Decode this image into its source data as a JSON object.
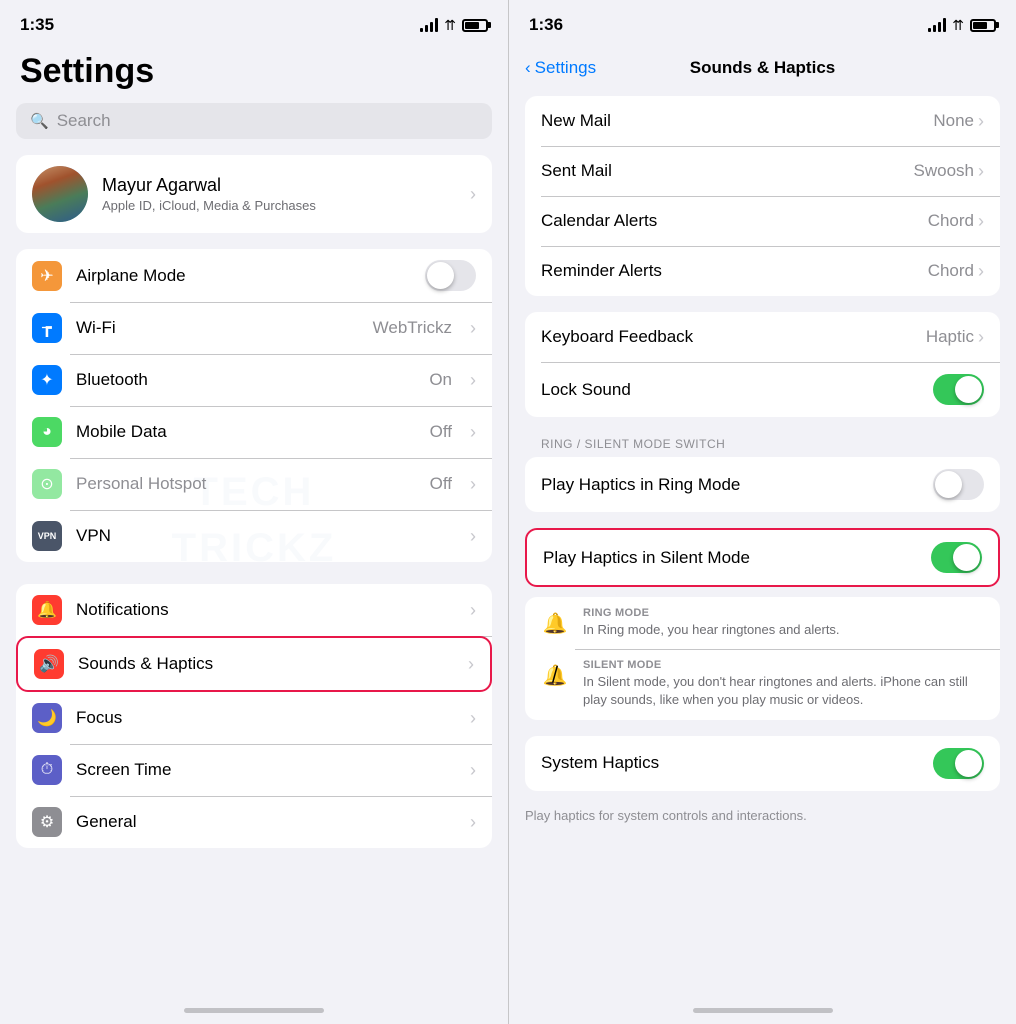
{
  "left": {
    "status": {
      "time": "1:35",
      "battery_label": "battery"
    },
    "title": "Settings",
    "search": {
      "placeholder": "Search"
    },
    "profile": {
      "name": "Mayur Agarwal",
      "subtitle": "Apple ID, iCloud, Media & Purchases"
    },
    "network_items": [
      {
        "id": "airplane",
        "label": "Airplane Mode",
        "value": "",
        "has_toggle": true,
        "toggle_on": false,
        "icon_bg": "#f4973a",
        "icon": "✈"
      },
      {
        "id": "wifi",
        "label": "Wi-Fi",
        "value": "WebTrickz",
        "has_toggle": false,
        "icon_bg": "#007aff",
        "icon": "📶"
      },
      {
        "id": "bluetooth",
        "label": "Bluetooth",
        "value": "On",
        "has_toggle": false,
        "icon_bg": "#007aff",
        "icon": "✦"
      },
      {
        "id": "mobile-data",
        "label": "Mobile Data",
        "value": "Off",
        "has_toggle": false,
        "icon_bg": "#4cd964",
        "icon": "📡"
      },
      {
        "id": "hotspot",
        "label": "Personal Hotspot",
        "value": "Off",
        "has_toggle": false,
        "icon_bg": "#4cd964",
        "icon": "⊙"
      },
      {
        "id": "vpn",
        "label": "VPN",
        "value": "",
        "has_toggle": false,
        "icon_bg": "#4a5568",
        "icon": "VPN"
      }
    ],
    "settings_items": [
      {
        "id": "notifications",
        "label": "Notifications",
        "icon_bg": "#ff3b30",
        "icon": "🔔",
        "highlighted": false
      },
      {
        "id": "sounds",
        "label": "Sounds & Haptics",
        "icon_bg": "#ff3b30",
        "icon": "🔊",
        "highlighted": true
      },
      {
        "id": "focus",
        "label": "Focus",
        "icon_bg": "#5c6bc0",
        "icon": "🌙",
        "highlighted": false
      },
      {
        "id": "screen-time",
        "label": "Screen Time",
        "icon_bg": "#5c6bc0",
        "icon": "⏱",
        "highlighted": false
      },
      {
        "id": "general",
        "label": "General",
        "icon_bg": "#8e8e93",
        "icon": "⚙",
        "highlighted": false
      }
    ]
  },
  "right": {
    "status": {
      "time": "1:36"
    },
    "nav": {
      "back_label": "Settings",
      "title": "Sounds & Haptics"
    },
    "alert_sounds": [
      {
        "id": "new-mail",
        "label": "New Mail",
        "value": "None"
      },
      {
        "id": "sent-mail",
        "label": "Sent Mail",
        "value": "Swoosh"
      },
      {
        "id": "calendar-alerts",
        "label": "Calendar Alerts",
        "value": "Chord"
      },
      {
        "id": "reminder-alerts",
        "label": "Reminder Alerts",
        "value": "Chord"
      }
    ],
    "feedback_items": [
      {
        "id": "keyboard-feedback",
        "label": "Keyboard Feedback",
        "value": "Haptic",
        "has_toggle": false
      },
      {
        "id": "lock-sound",
        "label": "Lock Sound",
        "value": "",
        "has_toggle": true,
        "toggle_on": true
      }
    ],
    "ring_silent_label": "RING / SILENT MODE SWITCH",
    "haptics_items": [
      {
        "id": "play-haptics-ring",
        "label": "Play Haptics in Ring Mode",
        "has_toggle": true,
        "toggle_on": false,
        "highlighted": false
      },
      {
        "id": "play-haptics-silent",
        "label": "Play Haptics in Silent Mode",
        "has_toggle": true,
        "toggle_on": true,
        "highlighted": true
      }
    ],
    "ring_mode": {
      "title": "RING MODE",
      "desc": "In Ring mode, you hear ringtones and alerts."
    },
    "silent_mode": {
      "title": "SILENT MODE",
      "desc": "In Silent mode, you don't hear ringtones and alerts. iPhone can still play sounds, like when you play music or videos."
    },
    "system_haptics": {
      "label": "System Haptics",
      "toggle_on": true,
      "desc": "Play haptics for system controls and interactions."
    }
  }
}
